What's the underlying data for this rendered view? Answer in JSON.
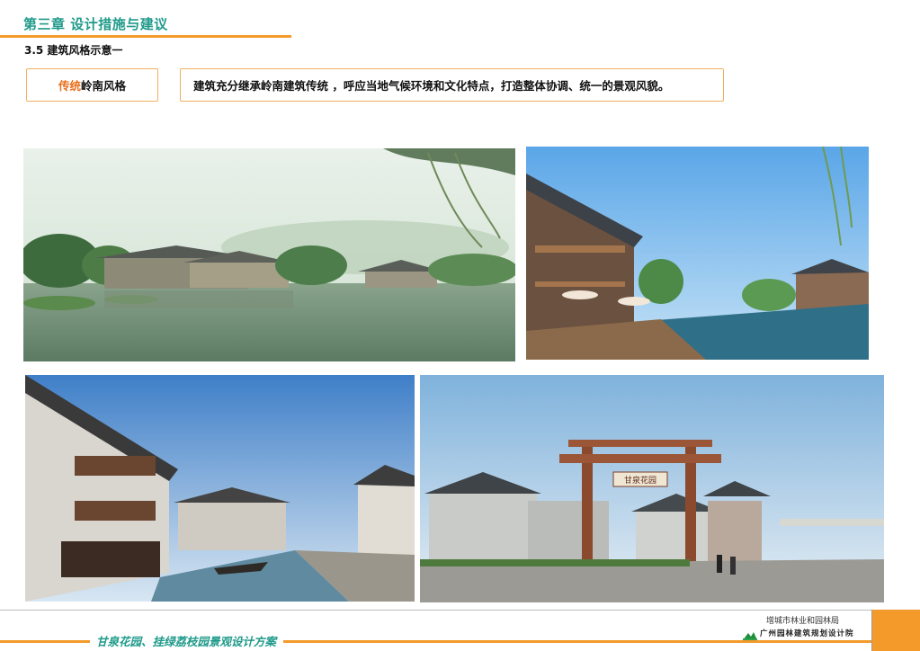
{
  "header": {
    "chapter_title": "第三章   设计措施与建议",
    "section_title": "3.5 建筑风格示意一"
  },
  "style_tag": {
    "accent": "传统",
    "rest": "岭南风格"
  },
  "description": "建筑充分继承岭南建筑传统 ，呼应当地气候环境和文化特点，打造整体协调、统一的景观风貌。",
  "gate_plaque": "甘泉花园",
  "footer": {
    "project_title": "甘泉花园、挂绿荔枝园景观设计方案",
    "org_line1": "增城市林业和园林局",
    "org_line2": "广州园林建筑规划设计院"
  },
  "colors": {
    "accent_orange": "#f39a2b",
    "teal": "#1f9a8a",
    "box_border": "#f0b060"
  }
}
